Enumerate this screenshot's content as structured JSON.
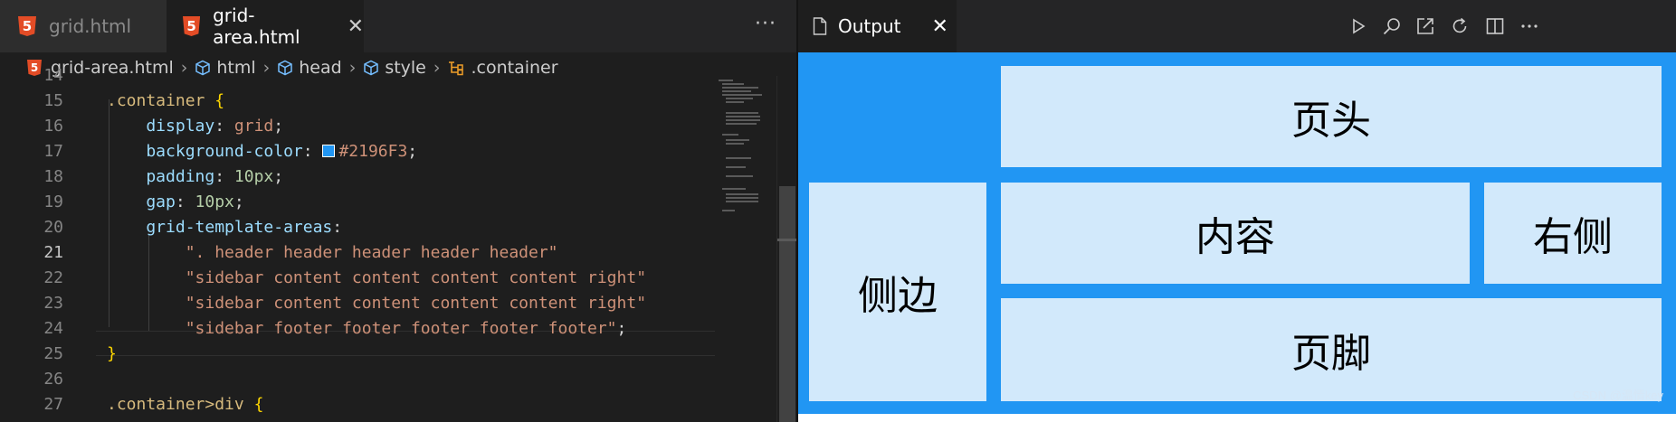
{
  "editor": {
    "tabs": [
      {
        "label": "grid.html",
        "active": false
      },
      {
        "label": "grid-area.html",
        "active": true
      }
    ],
    "more_label": "···",
    "breadcrumb": [
      "grid-area.html",
      "html",
      "head",
      "style",
      ".container"
    ],
    "lines": [
      {
        "n": "14",
        "parts": []
      },
      {
        "n": "15",
        "parts": [
          {
            "t": ".container",
            "c": "sel"
          },
          {
            "t": " ",
            "c": "pun"
          },
          {
            "t": "{",
            "c": "brace"
          }
        ]
      },
      {
        "n": "16",
        "parts": [
          {
            "t": "    display",
            "c": "prop"
          },
          {
            "t": ": ",
            "c": "pun"
          },
          {
            "t": "grid",
            "c": "val"
          },
          {
            "t": ";",
            "c": "pun"
          }
        ]
      },
      {
        "n": "17",
        "parts": [
          {
            "t": "    background-color",
            "c": "prop"
          },
          {
            "t": ": ",
            "c": "pun"
          },
          {
            "t": "",
            "c": "swatch"
          },
          {
            "t": "#2196F3",
            "c": "val"
          },
          {
            "t": ";",
            "c": "pun"
          }
        ]
      },
      {
        "n": "18",
        "parts": [
          {
            "t": "    padding",
            "c": "prop"
          },
          {
            "t": ": ",
            "c": "pun"
          },
          {
            "t": "10px",
            "c": "num"
          },
          {
            "t": ";",
            "c": "pun"
          }
        ]
      },
      {
        "n": "19",
        "parts": [
          {
            "t": "    gap",
            "c": "prop"
          },
          {
            "t": ": ",
            "c": "pun"
          },
          {
            "t": "10px",
            "c": "num"
          },
          {
            "t": ";",
            "c": "pun"
          }
        ]
      },
      {
        "n": "20",
        "parts": [
          {
            "t": "    grid-template-areas",
            "c": "prop"
          },
          {
            "t": ":",
            "c": "pun"
          }
        ]
      },
      {
        "n": "21",
        "parts": [
          {
            "t": "        \". header header header header header\"",
            "c": "val"
          }
        ]
      },
      {
        "n": "22",
        "parts": [
          {
            "t": "        \"sidebar content content content content right\"",
            "c": "val"
          }
        ]
      },
      {
        "n": "23",
        "parts": [
          {
            "t": "        \"sidebar content content content content right\"",
            "c": "val"
          }
        ]
      },
      {
        "n": "24",
        "parts": [
          {
            "t": "        \"sidebar footer footer footer footer footer\"",
            "c": "val"
          },
          {
            "t": ";",
            "c": "pun"
          }
        ]
      },
      {
        "n": "25",
        "parts": [
          {
            "t": "}",
            "c": "brace"
          }
        ]
      },
      {
        "n": "26",
        "parts": []
      },
      {
        "n": "27",
        "parts": [
          {
            "t": ".container>div ",
            "c": "sel"
          },
          {
            "t": "{",
            "c": "brace"
          }
        ]
      }
    ],
    "current_line": "21",
    "swatch_color": "#2196F3"
  },
  "output": {
    "tab_label": "Output",
    "close_label": "✕",
    "toolbar": [
      "play-icon",
      "search-icon",
      "open-external-icon",
      "refresh-icon",
      "split-editor-icon",
      "more-icon"
    ],
    "cells": {
      "header": "页头",
      "sidebar": "侧边",
      "content": "内容",
      "right": "右侧",
      "footer": "页脚"
    },
    "background": "#2196F3",
    "cell_color": "#d2e9fb"
  },
  "watermark": "CSDN @温情key"
}
